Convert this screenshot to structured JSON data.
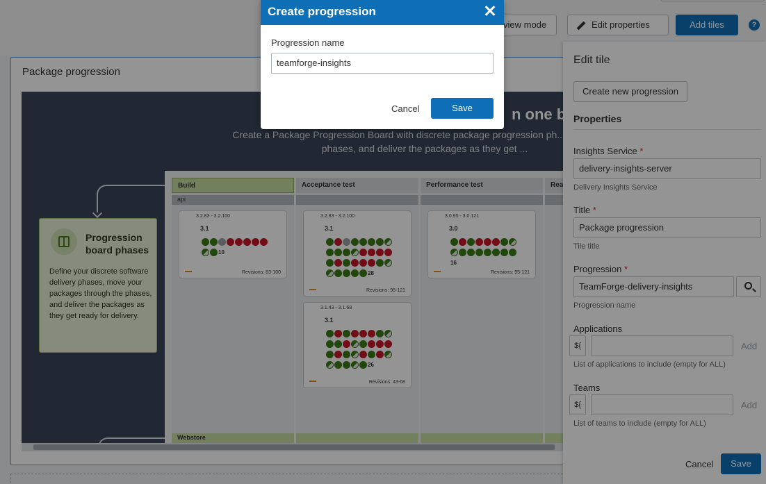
{
  "toolbar": {
    "view_mode_label": "view mode",
    "edit_properties_label": "Edit properties",
    "add_tiles_label": "Add tiles",
    "help_label": "?"
  },
  "tile": {
    "title": "Package progression",
    "hero_heading": "n one bo",
    "hero_subtitle": "Create a Package Progression Board with discrete package progression ph... through the phases, and deliver the packages as they get ...",
    "phase_card": {
      "title": "Progression board phases",
      "text": "Define your discrete software delivery phases, move your packages through the phases, and deliver the packages as they get ready for delivery."
    },
    "board": {
      "columns": [
        {
          "name": "Build",
          "sub": "api"
        },
        {
          "name": "Acceptance test",
          "sub": ""
        },
        {
          "name": "Performance test",
          "sub": ""
        },
        {
          "name": "Rea",
          "sub": ""
        }
      ],
      "footer_label": "Webstore",
      "cards": [
        {
          "range": "3.2.83 - 3.2.100",
          "version": "3.1",
          "count": "10",
          "revisions": "Revisions: 83-100"
        },
        {
          "range": "3.2.83 - 3.2.100",
          "version": "3.1",
          "count": "28",
          "revisions": "Revisions: 95-121"
        },
        {
          "range": "3.1.43 - 3.1.68",
          "version": "3.1",
          "count": "26",
          "revisions": "Revisions: 43-68"
        },
        {
          "range": "3.0.95 - 3.0.121",
          "version": "3.0",
          "count": "16",
          "revisions": "Revisions: 95-121"
        }
      ]
    }
  },
  "panel": {
    "title": "Edit tile",
    "create_new_label": "Create new progression",
    "properties_label": "Properties",
    "insights_service": {
      "label": "Insights Service",
      "value": "delivery-insights-server",
      "hint": "Delivery Insights Service"
    },
    "title_field": {
      "label": "Title",
      "value": "Package progression",
      "hint": "Tile title"
    },
    "progression": {
      "label": "Progression",
      "value": "TeamForge-delivery-insights",
      "hint": "Progression name"
    },
    "applications": {
      "label": "Applications",
      "expr": "${",
      "add": "Add",
      "hint": "List of applications to include (empty for ALL)"
    },
    "teams": {
      "label": "Teams",
      "expr": "${",
      "add": "Add",
      "hint": "List of teams to include (empty for ALL)"
    },
    "cancel_label": "Cancel",
    "save_label": "Save",
    "required_mark": "*"
  },
  "modal": {
    "title": "Create progression",
    "field_label": "Progression name",
    "field_value": "teamforge-insights",
    "cancel_label": "Cancel",
    "save_label": "Save"
  },
  "colors": {
    "accent": "#0f6fb6",
    "required": "#d02030",
    "build_green": "#c4dca0"
  }
}
